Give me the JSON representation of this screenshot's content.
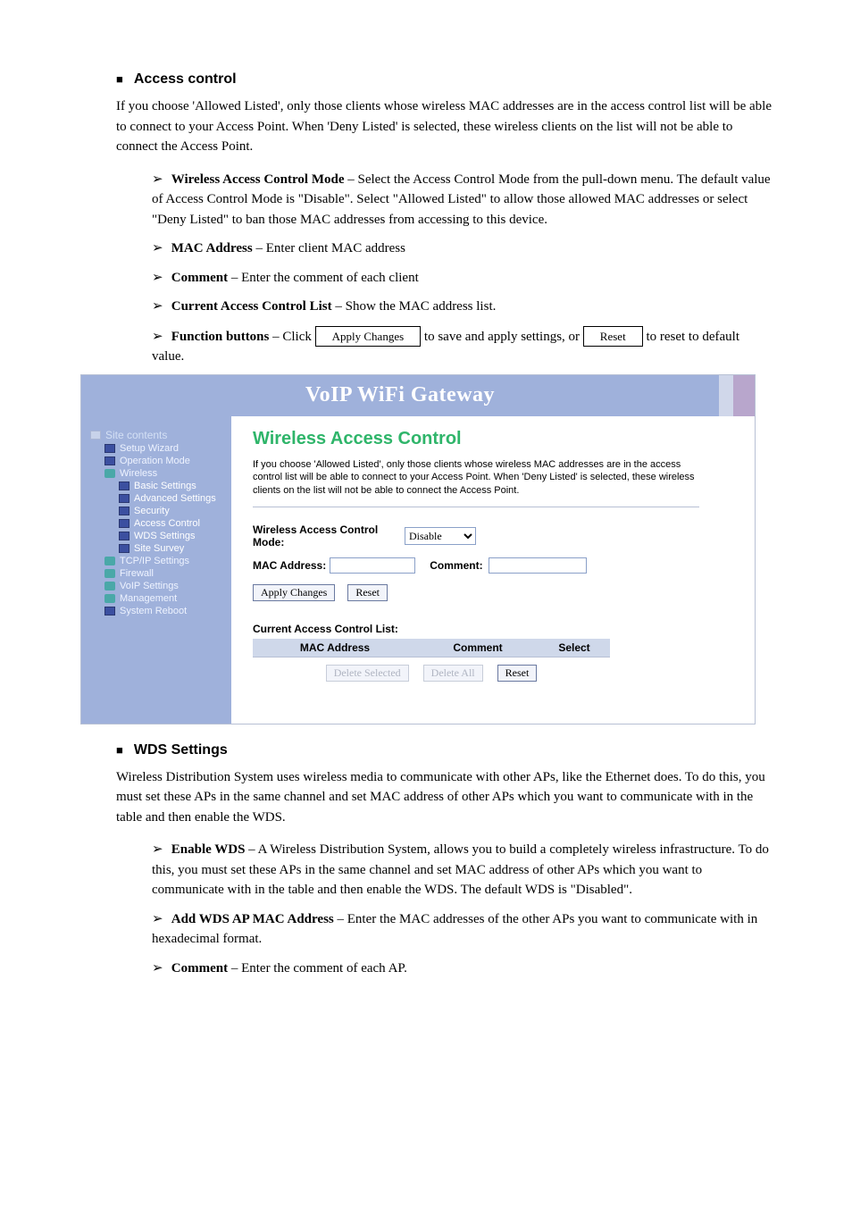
{
  "doc": {
    "section1": {
      "title": "Access control",
      "desc": "If you choose 'Allowed Listed', only those clients whose wireless MAC addresses are in the access control list will be able to connect to your Access Point. When 'Deny Listed' is selected, these wireless clients on the list will not be able to connect the Access Point.",
      "items": {
        "mode": {
          "label": "Wireless Access Control Mode",
          "text": " – Select the Access Control Mode from the pull-down menu. The default value of Access Control Mode is \"Disable\". Select \"Allowed Listed\" to allow those allowed MAC addresses or select \"Deny Listed\" to ban those MAC addresses from accessing to this device."
        },
        "mac": {
          "label": "MAC Address",
          "text": " – Enter client MAC address"
        },
        "comment": {
          "label": "Comment",
          "text": " – Enter the comment of each client"
        },
        "list": {
          "label": "Current Access Control List",
          "text": " – Show the MAC address list."
        },
        "func": {
          "label": "Function buttons",
          "pre": " – Click ",
          "btn1": "Apply Changes",
          "mid": " to save and apply settings, or ",
          "btn2": "Reset",
          "post": " to reset to default value."
        }
      }
    },
    "section2": {
      "title": "WDS Settings",
      "desc": "Wireless Distribution System uses wireless media to communicate with other APs, like the Ethernet does. To do this, you must set these APs in the same channel and set MAC address of other APs which you want to communicate with in the table and then enable the WDS.",
      "items": {
        "enable": {
          "label": "Enable WDS",
          "text": " – A Wireless Distribution System, allows you to build a completely wireless infrastructure. To do this, you must set these APs in the same channel and set MAC address of other APs which you want to communicate with in the table and then enable the WDS. The default WDS is \"Disabled\"."
        },
        "mac": {
          "label": "Add WDS AP MAC Address",
          "text": " – Enter the MAC addresses of the other APs you want to communicate with in hexadecimal format."
        },
        "comment": {
          "label": "Comment",
          "text": " – Enter the comment of each AP."
        }
      }
    }
  },
  "shot": {
    "banner": "VoIP WiFi Gateway",
    "sidebar": {
      "title": "Site contents",
      "items": [
        {
          "depth": 1,
          "icon": "sheet",
          "label": "Setup Wizard"
        },
        {
          "depth": 1,
          "icon": "sheet",
          "label": "Operation Mode"
        },
        {
          "depth": 1,
          "icon": "folder",
          "label": "Wireless"
        },
        {
          "depth": 2,
          "icon": "sheet",
          "label": "Basic Settings"
        },
        {
          "depth": 2,
          "icon": "sheet",
          "label": "Advanced Settings"
        },
        {
          "depth": 2,
          "icon": "sheet",
          "label": "Security"
        },
        {
          "depth": 2,
          "icon": "sheet",
          "label": "Access Control"
        },
        {
          "depth": 2,
          "icon": "sheet",
          "label": "WDS Settings"
        },
        {
          "depth": 2,
          "icon": "sheet",
          "label": "Site Survey"
        },
        {
          "depth": 1,
          "icon": "folder",
          "label": "TCP/IP Settings"
        },
        {
          "depth": 1,
          "icon": "folder",
          "label": "Firewall"
        },
        {
          "depth": 1,
          "icon": "folder",
          "label": "VoIP Settings"
        },
        {
          "depth": 1,
          "icon": "folder",
          "label": "Management"
        },
        {
          "depth": 1,
          "icon": "sheet",
          "label": "System Reboot"
        }
      ]
    },
    "content": {
      "heading": "Wireless Access Control",
      "desc": "If you choose 'Allowed Listed', only those clients whose wireless MAC addresses are in the access control list will be able to connect to your Access Point. When 'Deny Listed' is selected, these wireless clients on the list will not be able to connect the Access Point.",
      "modeLabel": "Wireless Access Control Mode:",
      "modeValue": "Disable",
      "macLabel": "MAC Address:",
      "commentLabel": "Comment:",
      "applyBtn": "Apply Changes",
      "resetBtn": "Reset",
      "listHeader": "Current Access Control List:",
      "table": {
        "col1": "MAC Address",
        "col2": "Comment",
        "col3": "Select"
      },
      "delSelBtn": "Delete Selected",
      "delAllBtn": "Delete All",
      "reset2Btn": "Reset"
    }
  }
}
